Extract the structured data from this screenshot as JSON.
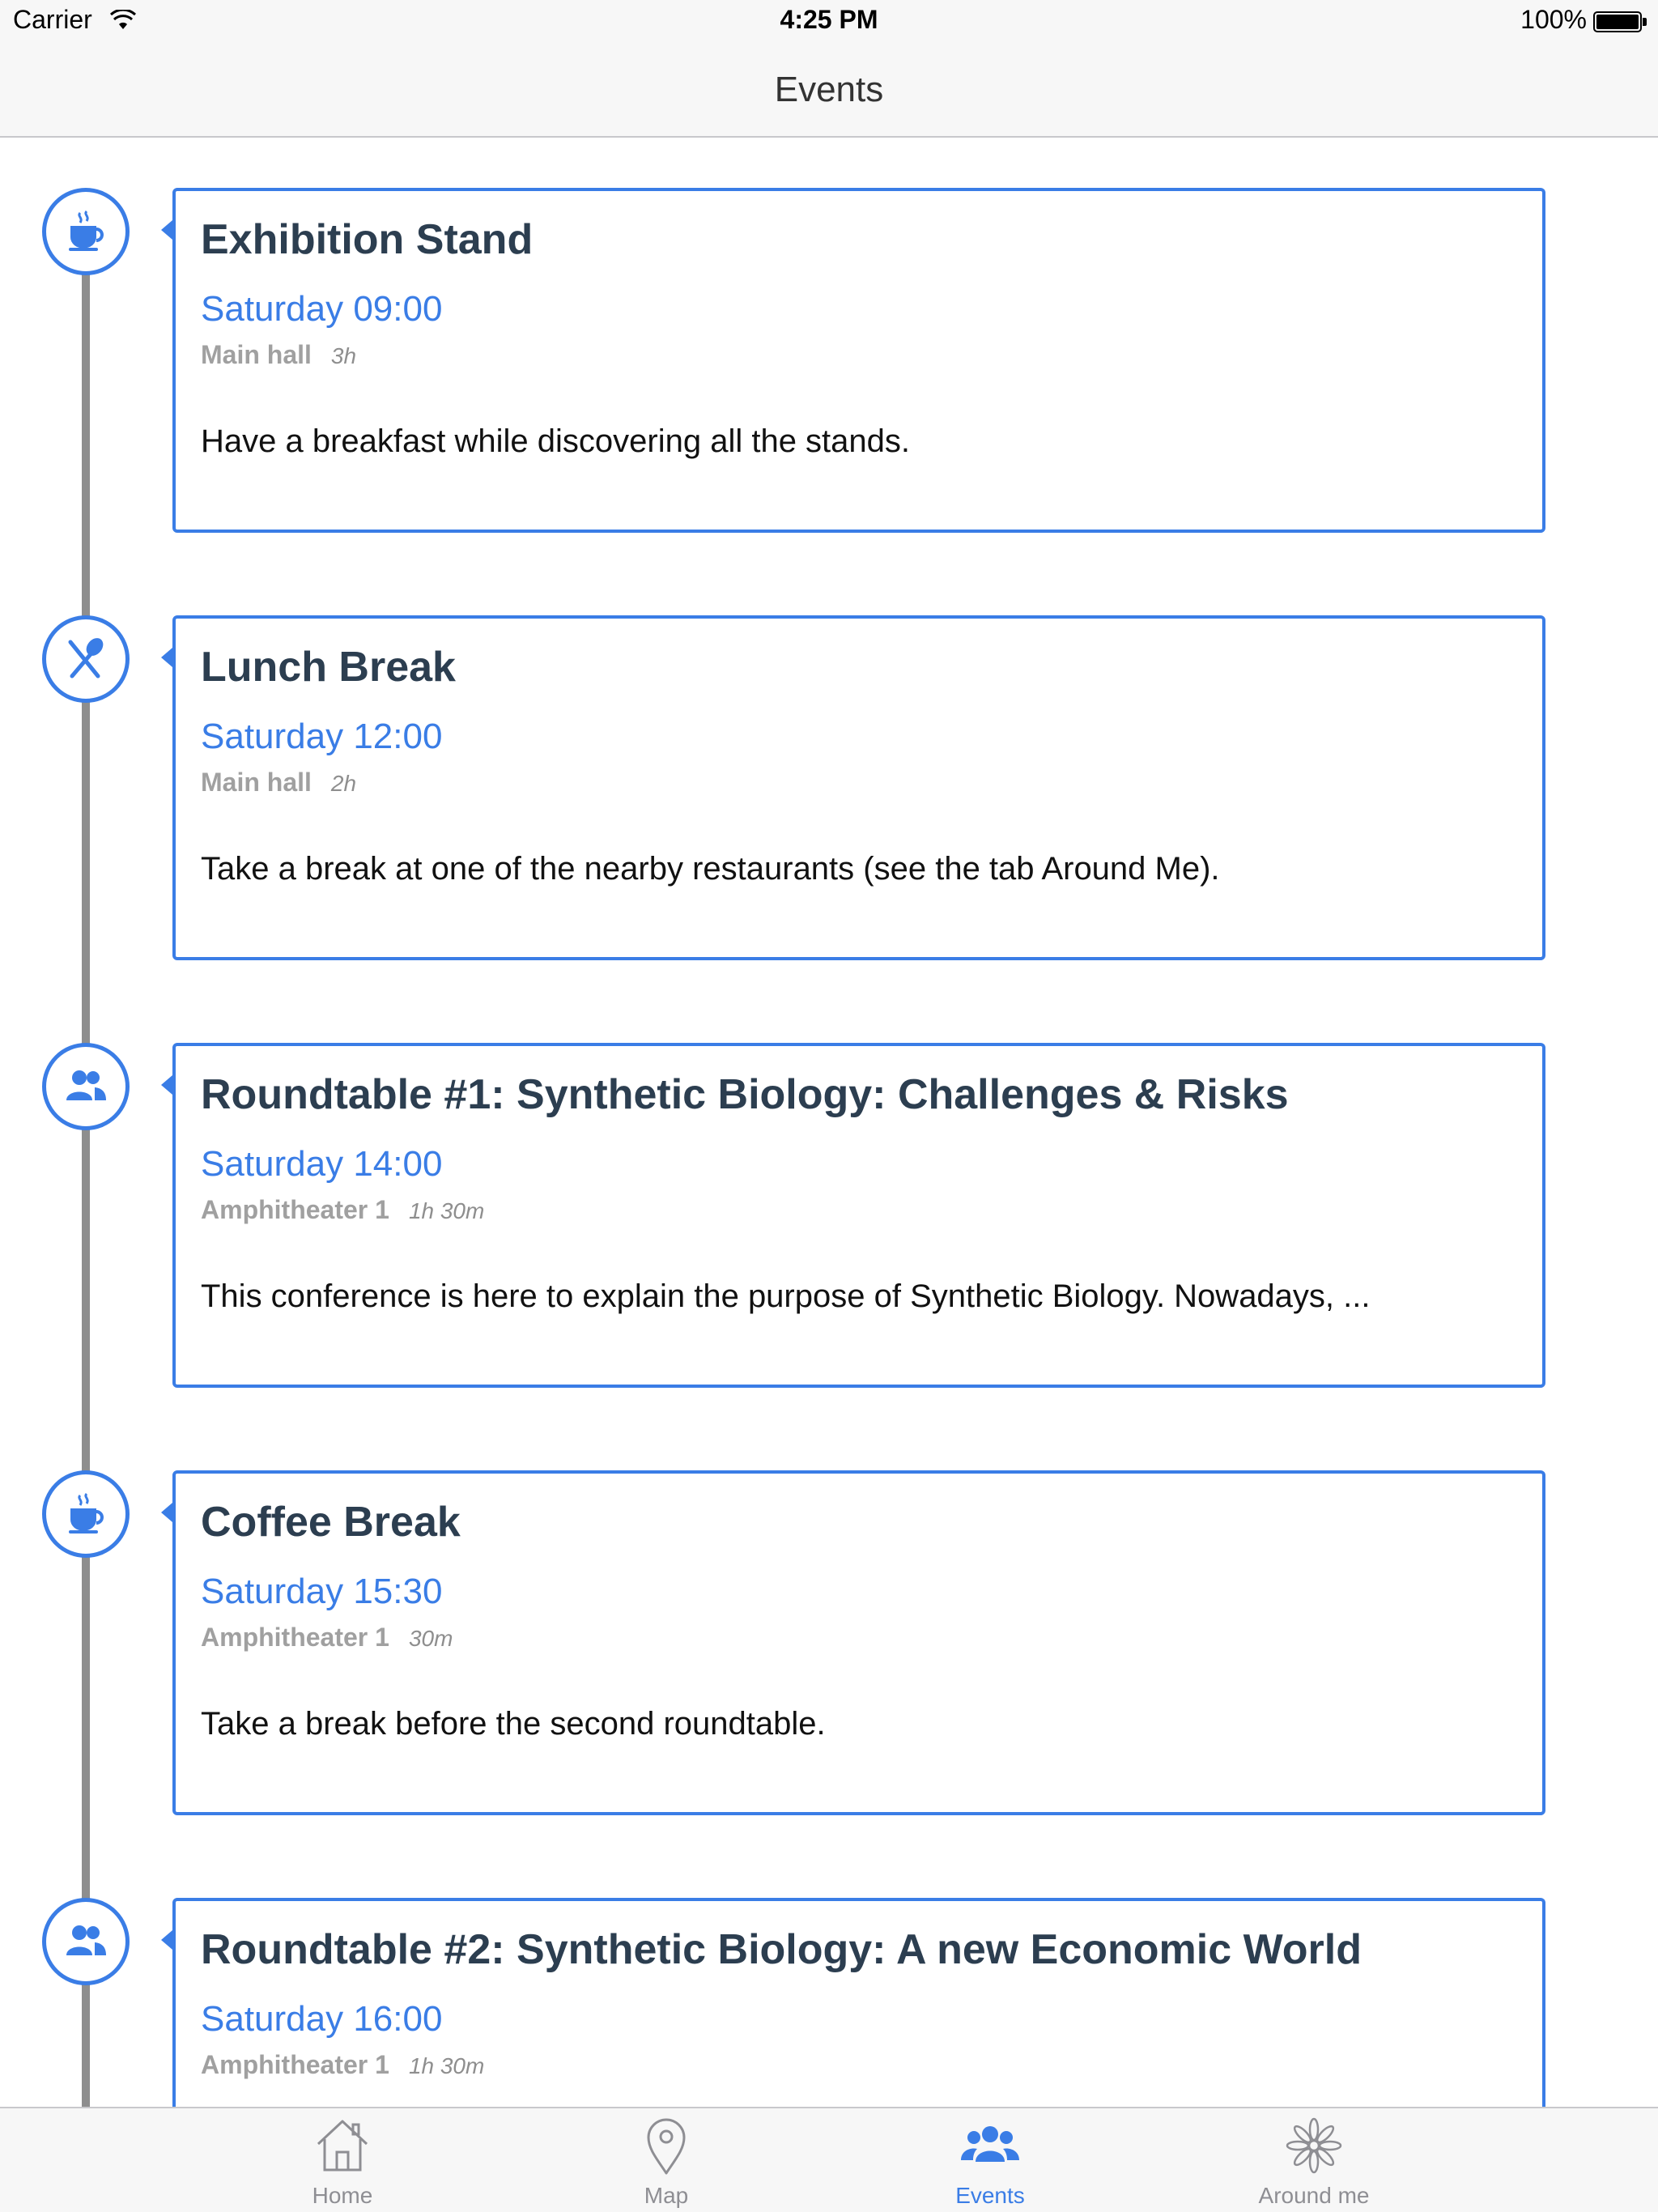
{
  "status_bar": {
    "carrier": "Carrier",
    "time": "4:25 PM",
    "battery": "100%"
  },
  "nav": {
    "title": "Events"
  },
  "events": [
    {
      "icon": "coffee-cup-icon",
      "title": "Exhibition Stand",
      "time": "Saturday 09:00",
      "location": "Main hall",
      "duration": "3h",
      "description": "Have a breakfast while discovering all the stands."
    },
    {
      "icon": "fork-spoon-icon",
      "title": "Lunch Break",
      "time": "Saturday 12:00",
      "location": "Main hall",
      "duration": "2h",
      "description": "Take a break at one of the nearby restaurants (see the tab Around Me)."
    },
    {
      "icon": "people-icon",
      "title": "Roundtable #1: Synthetic Biology: Challenges & Risks",
      "time": "Saturday 14:00",
      "location": "Amphitheater 1",
      "duration": "1h 30m",
      "description": "This conference is here to explain the purpose of Synthetic Biology. Nowadays, ..."
    },
    {
      "icon": "coffee-cup-icon",
      "title": "Coffee Break",
      "time": "Saturday 15:30",
      "location": "Amphitheater 1",
      "duration": "30m",
      "description": "Take a break before the second roundtable."
    },
    {
      "icon": "people-icon",
      "title": "Roundtable #2: Synthetic Biology: A new Economic World",
      "time": "Saturday 16:00",
      "location": "Amphitheater 1",
      "duration": "1h 30m",
      "description": ""
    }
  ],
  "tabs": [
    {
      "label": "Home",
      "icon": "home-icon",
      "active": false
    },
    {
      "label": "Map",
      "icon": "map-pin-icon",
      "active": false
    },
    {
      "label": "Events",
      "icon": "people-icon",
      "active": true
    },
    {
      "label": "Around me",
      "icon": "flower-icon",
      "active": false
    }
  ],
  "colors": {
    "accent": "#3a7de6",
    "timeline": "#8e8e8e",
    "title_text": "#2c3e50",
    "meta_text": "#a0a0a0"
  }
}
